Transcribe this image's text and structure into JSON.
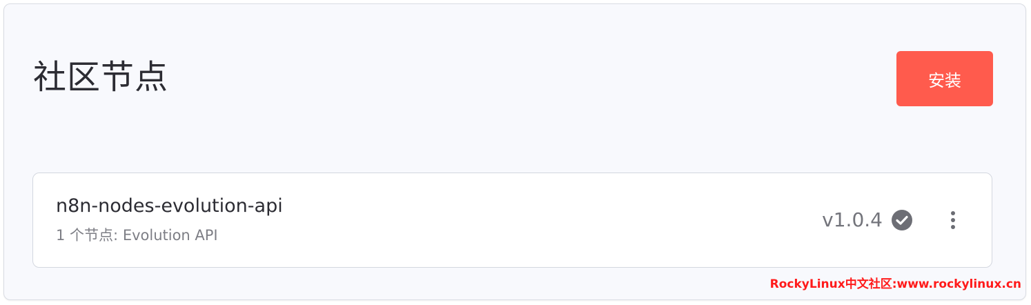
{
  "header": {
    "title": "社区节点",
    "install_label": "安装"
  },
  "node": {
    "name": "n8n-nodes-evolution-api",
    "subtitle_prefix": "1 个节点:",
    "subtitle_nodes": "Evolution API",
    "version": "v1.0.4",
    "status_icon": "verified-check-icon",
    "menu_icon": "more-vertical-icon"
  },
  "watermark": "RockyLinux中文社区:www.rockylinux.cn",
  "colors": {
    "accent": "#ff5b4d",
    "background": "#f8f9fd",
    "text": "#2c2c33",
    "muted": "#7d7e85",
    "watermark": "#ff1a1a"
  }
}
